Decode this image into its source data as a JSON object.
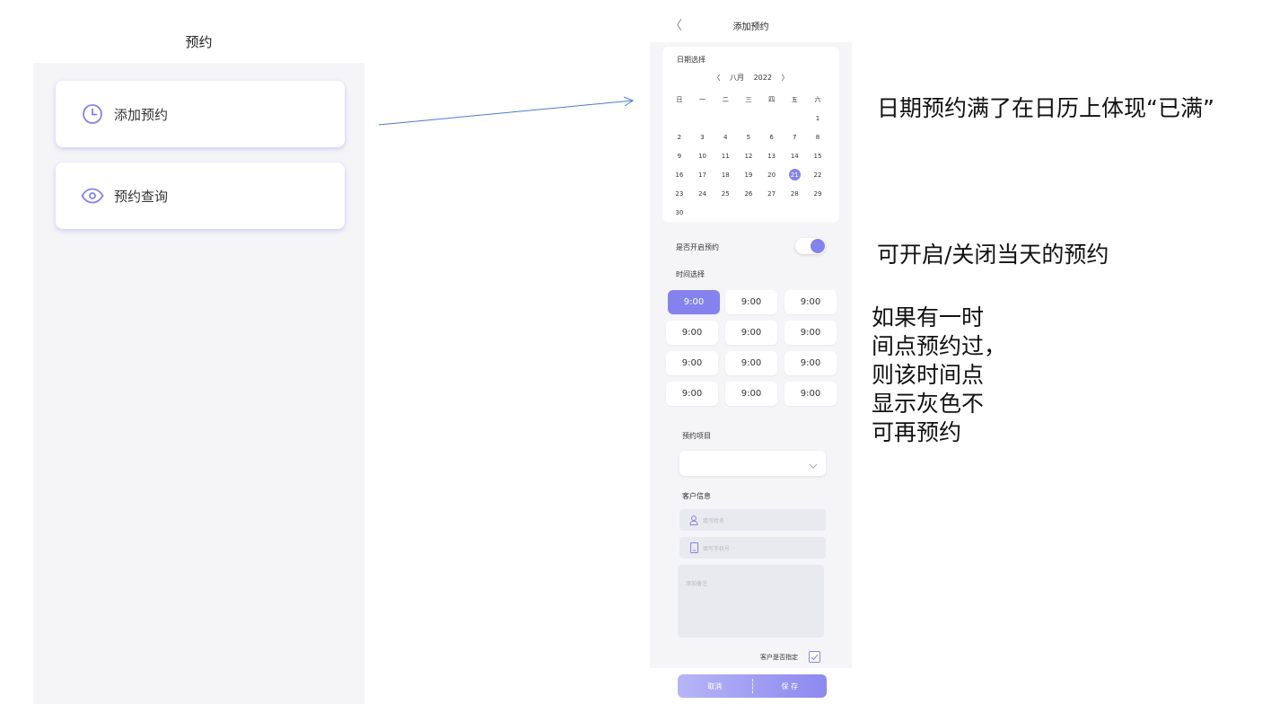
{
  "left": {
    "title": "预约",
    "menu": [
      {
        "label": "添加预约",
        "icon": "clock-icon"
      },
      {
        "label": "预约查询",
        "icon": "eye-icon"
      }
    ]
  },
  "phone": {
    "back_icon": "chevron-left-icon",
    "back_glyph": "〈",
    "title": "添加预约",
    "date_section_label": "日期选择",
    "calendar": {
      "prev_glyph": "〈",
      "month": "八月",
      "year": "2022",
      "next_glyph": "〉",
      "weekdays": [
        "日",
        "一",
        "二",
        "三",
        "四",
        "五",
        "六"
      ],
      "weeks": [
        [
          "",
          "",
          "",
          "",
          "",
          "",
          "1"
        ],
        [
          "2",
          "3",
          "4",
          "5",
          "6",
          "7",
          "8"
        ],
        [
          "9",
          "10",
          "11",
          "12",
          "13",
          "14",
          "15"
        ],
        [
          "16",
          "17",
          "18",
          "19",
          "20",
          "21",
          "22"
        ],
        [
          "23",
          "24",
          "25",
          "26",
          "27",
          "28",
          "29"
        ],
        [
          "30",
          "",
          "",
          "",
          "",
          "",
          ""
        ]
      ],
      "selected_day": "21"
    },
    "toggle_label": "是否开启预约",
    "toggle_on": true,
    "time_section_label": "时间选择",
    "time_slots": [
      "9:00",
      "9:00",
      "9:00",
      "9:00",
      "9:00",
      "9:00",
      "9:00",
      "9:00",
      "9:00",
      "9:00",
      "9:00",
      "9:00"
    ],
    "active_slot_index": 0,
    "item_label": "预约项目",
    "item_value": "",
    "customer_label": "客户信息",
    "name_placeholder": "填写姓名",
    "phone_placeholder": "填写手机号",
    "notes_placeholder": "添加备注",
    "specify_label": "客户是否指定",
    "specify_checked": true,
    "cancel_label": "取消",
    "save_label": "保 存",
    "accent_color": "#8582ee"
  },
  "annotations": {
    "note1": "日期预约满了在日历上体现“已满”",
    "note2": "可开启/关闭当天的预约",
    "note3_lines": [
      "如果有一时",
      "间点预约过，",
      "则该时间点",
      "显示灰色不",
      "可再预约"
    ]
  }
}
